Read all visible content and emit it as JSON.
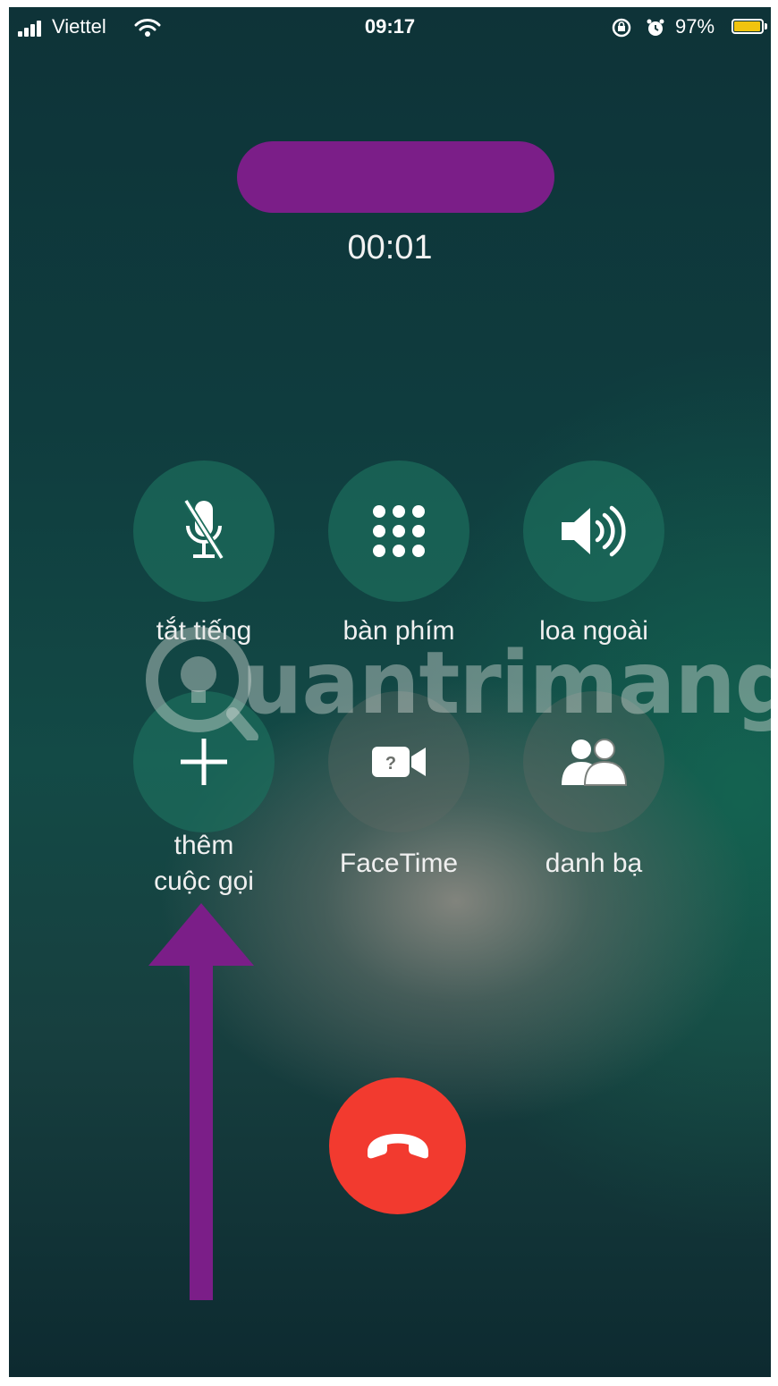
{
  "status_bar": {
    "carrier": "Viettel",
    "time": "09:17",
    "battery_percent": "97%",
    "battery_level": 0.97,
    "battery_color": "#f1c40f"
  },
  "call": {
    "timer": "00:01"
  },
  "controls": {
    "mute": {
      "label": "tắt tiếng",
      "icon": "mic-slash-icon"
    },
    "keypad": {
      "label": "bàn phím",
      "icon": "keypad-icon"
    },
    "speaker": {
      "label": "loa ngoài",
      "icon": "speaker-icon"
    },
    "add_call": {
      "label_line1": "thêm",
      "label_line2": "cuộc gọi",
      "icon": "plus-icon"
    },
    "facetime": {
      "label": "FaceTime",
      "icon": "facetime-video-icon"
    },
    "contacts": {
      "label": "danh bạ",
      "icon": "contacts-icon"
    }
  },
  "end_call": {
    "icon": "phone-hangup-icon",
    "color": "#f23a2f"
  },
  "annotation": {
    "arrow_color": "#7b1e88",
    "redaction_color": "#7b1e88"
  },
  "watermark": {
    "text": "uantrimang"
  }
}
